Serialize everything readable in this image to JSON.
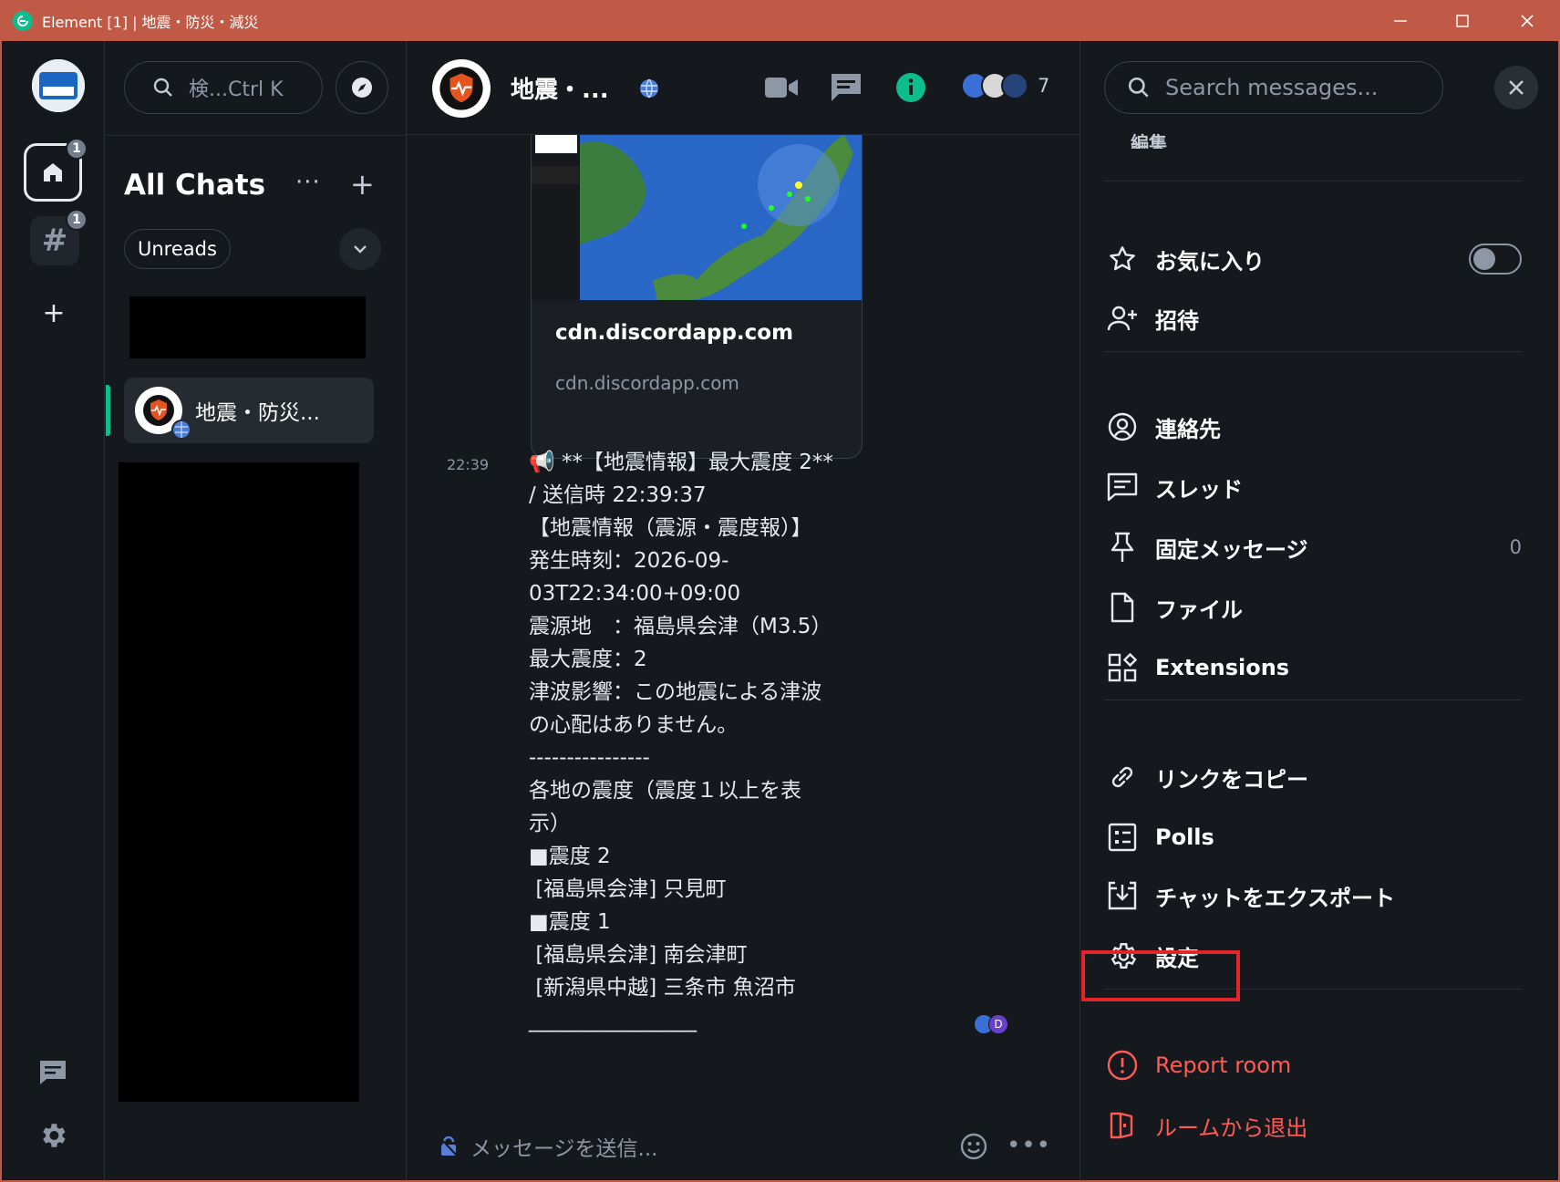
{
  "window": {
    "title": "Element [1] | 地震・防災・減災",
    "controls": [
      "minimize",
      "maximize",
      "close"
    ]
  },
  "spacebar": {
    "home_badge": "1",
    "space_badge": "1",
    "space_symbol": "#",
    "add_symbol": "+"
  },
  "roomlist": {
    "search_placeholder": "検...Ctrl K",
    "heading": "All Chats",
    "more": "···",
    "add": "+",
    "filter": "Unreads",
    "rooms": [
      {
        "name": "地震・防災...",
        "selected": true
      }
    ]
  },
  "timeline": {
    "room_name": "地震・...",
    "member_count": "7",
    "preview_card": {
      "title": "cdn.discordapp.com",
      "url": "cdn.discordapp.com"
    },
    "message": {
      "time": "22:39",
      "body": "📢 **【地震情報】最大震度 2**\n/ 送信時 22:39:37\n【地震情報（震源・震度報）】\n発生時刻：2026-09-\n03T22:34:00+09:00\n震源地　：福島県会津（M3.5）\n最大震度：2\n津波影響：この地震による津波\nの心配はありません。\n----------------\n各地の震度（震度１以上を表\n示）\n■震度 2\n [福島県会津] 只見町\n■震度 1\n [福島県会津] 南会津町\n [新潟県中越] 三条市 魚沼市\n________________"
    },
    "read_receipt_letter": "D",
    "composer_placeholder": "メッセージを送信..."
  },
  "rightpanel": {
    "search_placeholder": "Search messages...",
    "edit_label": "編集",
    "favourite": {
      "label": "お気に入り",
      "enabled": false
    },
    "invite": "招待",
    "people": "連絡先",
    "threads": "スレッド",
    "pinned": {
      "label": "固定メッセージ",
      "count": "0"
    },
    "files": "ファイル",
    "extensions": "Extensions",
    "copy_link": "リンクをコピー",
    "polls": "Polls",
    "export_chat": "チャットをエクスポート",
    "settings": "設定",
    "report_room": "Report room",
    "leave_room": "ルームから退出"
  },
  "colors": {
    "accent": "#0dbd8b",
    "danger": "#ff5b55",
    "highlight": "#e0262b",
    "titlebar": "#c05a47"
  }
}
